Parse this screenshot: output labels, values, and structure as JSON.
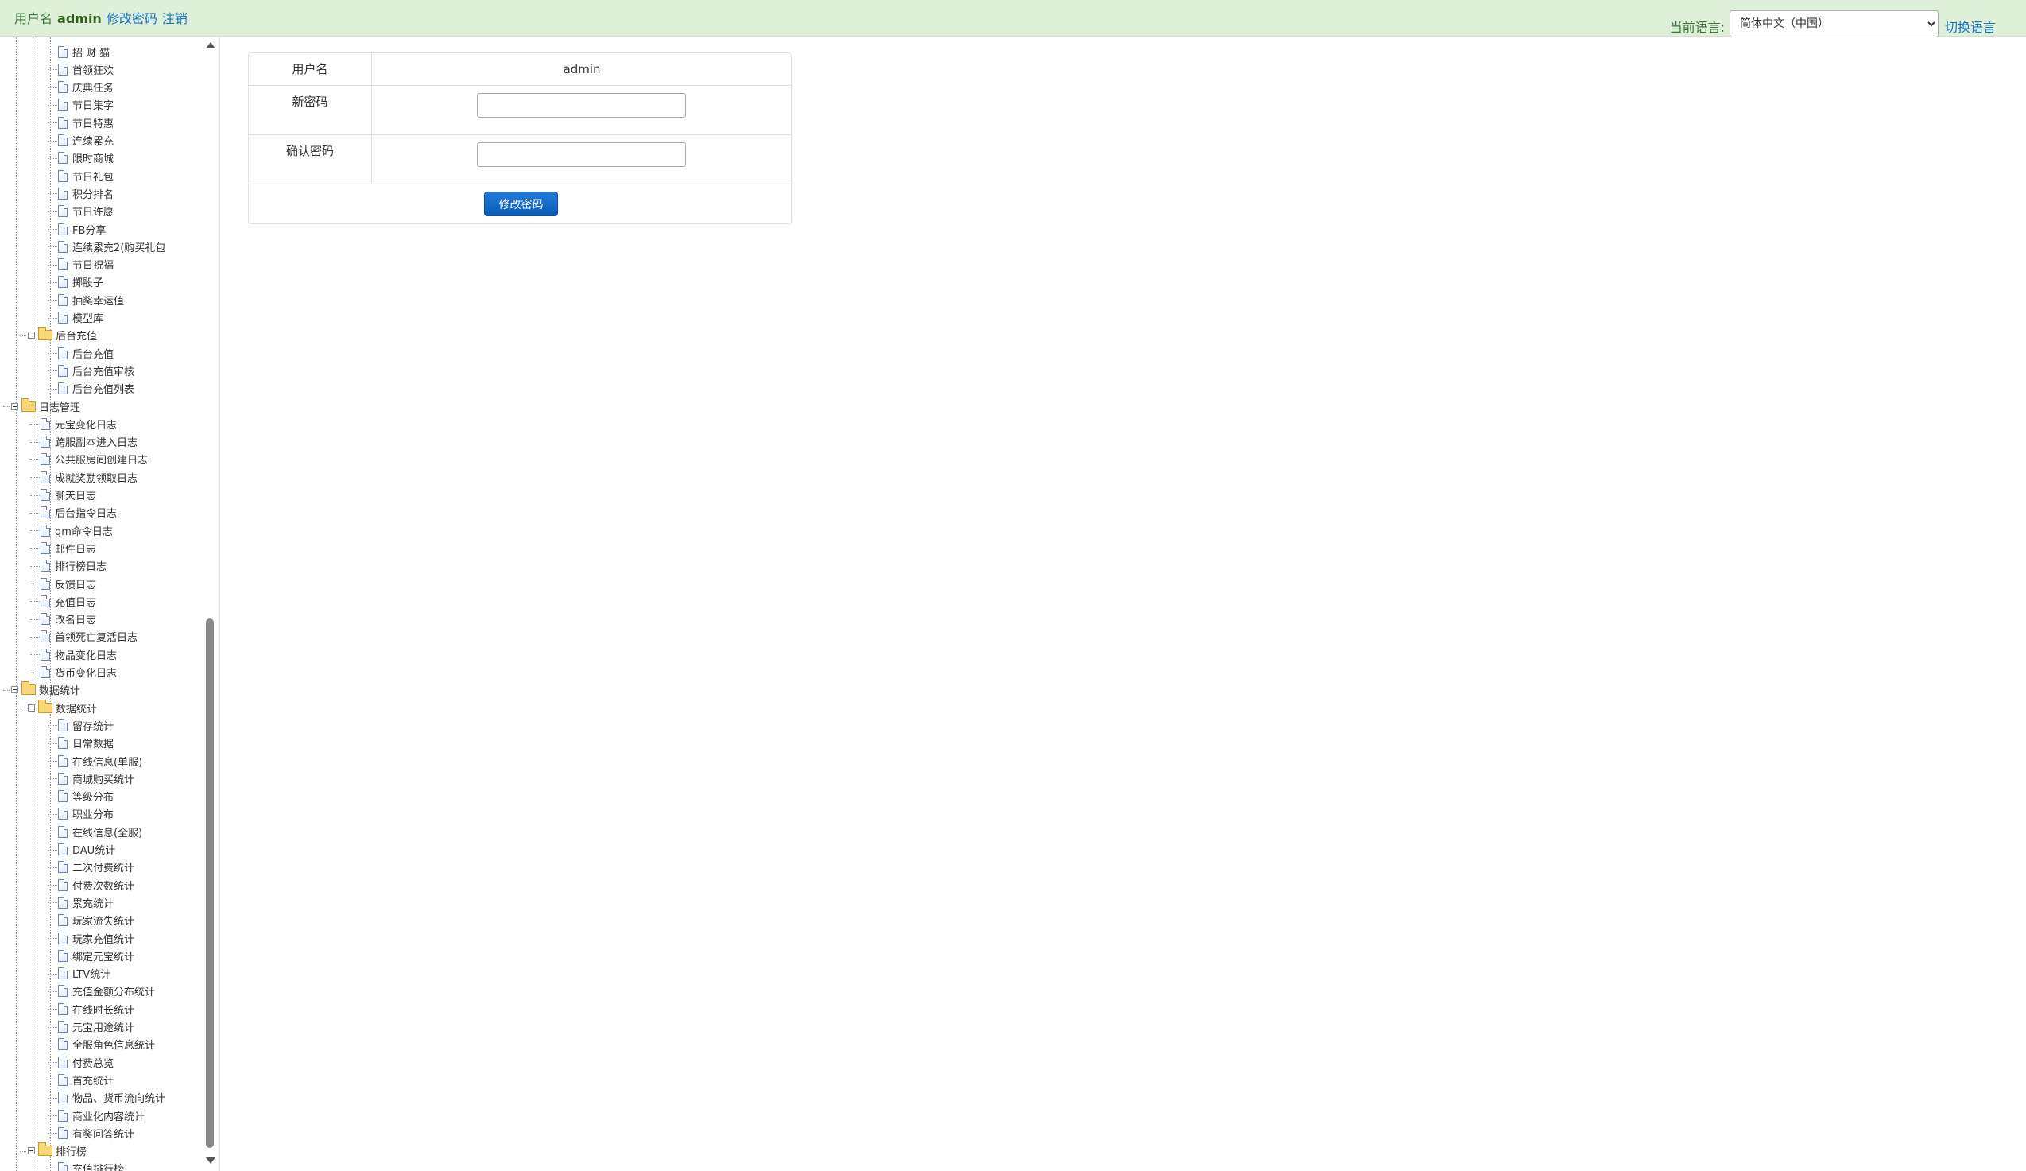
{
  "topbar": {
    "username_label": "用户名",
    "username": "admin",
    "change_password_link": "修改密码",
    "logout_link": "注销",
    "language_label": "当前语言:",
    "language_selected": "简体中文（中国）",
    "switch_language_link": "切换语言"
  },
  "form": {
    "username_label": "用户名",
    "username_value": "admin",
    "new_password_label": "新密码",
    "confirm_password_label": "确认密码",
    "submit_label": "修改密码"
  },
  "tree": [
    {
      "level": 3,
      "type": "doc",
      "label": "招 财 猫"
    },
    {
      "level": 3,
      "type": "doc",
      "label": "首领狂欢"
    },
    {
      "level": 3,
      "type": "doc",
      "label": "庆典任务"
    },
    {
      "level": 3,
      "type": "doc",
      "label": "节日集字"
    },
    {
      "level": 3,
      "type": "doc",
      "label": "节日特惠"
    },
    {
      "level": 3,
      "type": "doc",
      "label": "连续累充"
    },
    {
      "level": 3,
      "type": "doc",
      "label": "限时商城"
    },
    {
      "level": 3,
      "type": "doc",
      "label": "节日礼包"
    },
    {
      "level": 3,
      "type": "doc",
      "label": "积分排名"
    },
    {
      "level": 3,
      "type": "doc",
      "label": "节日许愿"
    },
    {
      "level": 3,
      "type": "doc",
      "label": "FB分享"
    },
    {
      "level": 3,
      "type": "doc",
      "label": "连续累充2(购买礼包"
    },
    {
      "level": 3,
      "type": "doc",
      "label": "节日祝福"
    },
    {
      "level": 3,
      "type": "doc",
      "label": "掷骰子"
    },
    {
      "level": 3,
      "type": "doc",
      "label": "抽奖幸运值"
    },
    {
      "level": 3,
      "type": "doc",
      "label": "模型库"
    },
    {
      "level": 2,
      "type": "folder",
      "label": "后台充值"
    },
    {
      "level": 3,
      "type": "doc",
      "label": "后台充值"
    },
    {
      "level": 3,
      "type": "doc",
      "label": "后台充值审核"
    },
    {
      "level": 3,
      "type": "doc",
      "label": "后台充值列表"
    },
    {
      "level": 1,
      "type": "folder",
      "label": "日志管理"
    },
    {
      "level": 2,
      "type": "doc",
      "label": "元宝变化日志"
    },
    {
      "level": 2,
      "type": "doc",
      "label": "跨服副本进入日志"
    },
    {
      "level": 2,
      "type": "doc",
      "label": "公共服房间创建日志"
    },
    {
      "level": 2,
      "type": "doc",
      "label": "成就奖励领取日志"
    },
    {
      "level": 2,
      "type": "doc",
      "label": "聊天日志"
    },
    {
      "level": 2,
      "type": "doc",
      "label": "后台指令日志"
    },
    {
      "level": 2,
      "type": "doc",
      "label": "gm命令日志"
    },
    {
      "level": 2,
      "type": "doc",
      "label": "邮件日志"
    },
    {
      "level": 2,
      "type": "doc",
      "label": "排行榜日志"
    },
    {
      "level": 2,
      "type": "doc",
      "label": "反馈日志"
    },
    {
      "level": 2,
      "type": "doc",
      "label": "充值日志"
    },
    {
      "level": 2,
      "type": "doc",
      "label": "改名日志"
    },
    {
      "level": 2,
      "type": "doc",
      "label": "首领死亡复活日志"
    },
    {
      "level": 2,
      "type": "doc",
      "label": "物品变化日志"
    },
    {
      "level": 2,
      "type": "doc",
      "label": "货币变化日志"
    },
    {
      "level": 1,
      "type": "folder",
      "label": "数据统计"
    },
    {
      "level": 2,
      "type": "folder",
      "label": "数据统计"
    },
    {
      "level": 3,
      "type": "doc",
      "label": "留存统计"
    },
    {
      "level": 3,
      "type": "doc",
      "label": "日常数据"
    },
    {
      "level": 3,
      "type": "doc",
      "label": "在线信息(单服)"
    },
    {
      "level": 3,
      "type": "doc",
      "label": "商城购买统计"
    },
    {
      "level": 3,
      "type": "doc",
      "label": "等级分布"
    },
    {
      "level": 3,
      "type": "doc",
      "label": "职业分布"
    },
    {
      "level": 3,
      "type": "doc",
      "label": "在线信息(全服)"
    },
    {
      "level": 3,
      "type": "doc",
      "label": "DAU统计"
    },
    {
      "level": 3,
      "type": "doc",
      "label": "二次付费统计"
    },
    {
      "level": 3,
      "type": "doc",
      "label": "付费次数统计"
    },
    {
      "level": 3,
      "type": "doc",
      "label": "累充统计"
    },
    {
      "level": 3,
      "type": "doc",
      "label": "玩家流失统计"
    },
    {
      "level": 3,
      "type": "doc",
      "label": "玩家充值统计"
    },
    {
      "level": 3,
      "type": "doc",
      "label": "绑定元宝统计"
    },
    {
      "level": 3,
      "type": "doc",
      "label": "LTV统计"
    },
    {
      "level": 3,
      "type": "doc",
      "label": "充值金额分布统计"
    },
    {
      "level": 3,
      "type": "doc",
      "label": "在线时长统计"
    },
    {
      "level": 3,
      "type": "doc",
      "label": "元宝用途统计"
    },
    {
      "level": 3,
      "type": "doc",
      "label": "全服角色信息统计"
    },
    {
      "level": 3,
      "type": "doc",
      "label": "付费总览"
    },
    {
      "level": 3,
      "type": "doc",
      "label": "首充统计"
    },
    {
      "level": 3,
      "type": "doc",
      "label": "物品、货币流向统计"
    },
    {
      "level": 3,
      "type": "doc",
      "label": "商业化内容统计"
    },
    {
      "level": 3,
      "type": "doc",
      "label": "有奖问答统计"
    },
    {
      "level": 2,
      "type": "folder",
      "label": "排行榜"
    },
    {
      "level": 3,
      "type": "doc",
      "label": "充值排行榜"
    }
  ]
}
